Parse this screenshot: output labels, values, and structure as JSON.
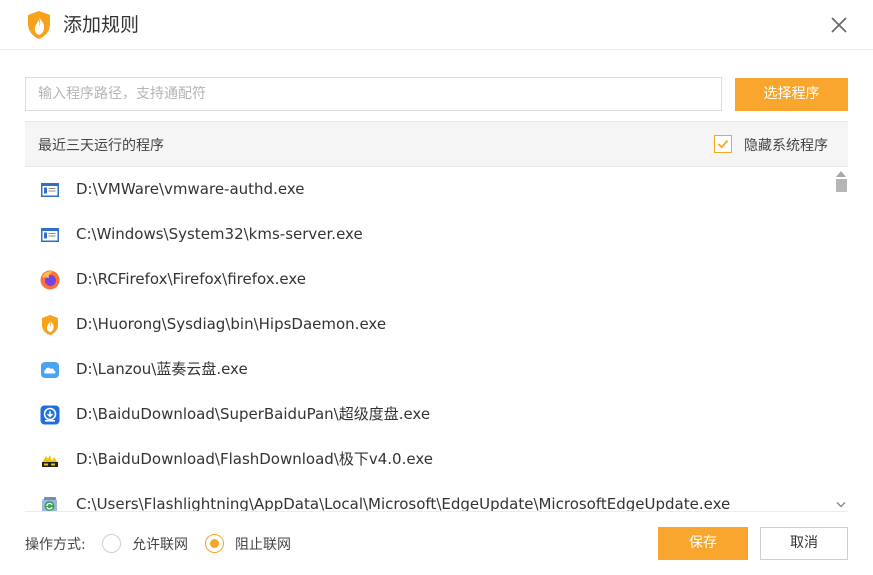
{
  "dialog": {
    "title": "添加规则",
    "app_icon": "huorong-flame-icon",
    "close_icon": "close-icon"
  },
  "search": {
    "placeholder": "输入程序路径，支持通配符",
    "value": "",
    "select_button": "选择程序"
  },
  "list_header": {
    "title": "最近三天运行的程序",
    "hide_system_label": "隐藏系统程序",
    "hide_system_checked": true
  },
  "programs": [
    {
      "path": "D:\\VMWare\\vmware-authd.exe",
      "icon": "window-app-icon"
    },
    {
      "path": "C:\\Windows\\System32\\kms-server.exe",
      "icon": "window-app-icon"
    },
    {
      "path": "D:\\RCFirefox\\Firefox\\firefox.exe",
      "icon": "firefox-icon"
    },
    {
      "path": "D:\\Huorong\\Sysdiag\\bin\\HipsDaemon.exe",
      "icon": "huorong-flame-icon"
    },
    {
      "path": "D:\\Lanzou\\蓝奏云盘.exe",
      "icon": "cloud-icon"
    },
    {
      "path": "D:\\BaiduDownload\\SuperBaiduPan\\超级度盘.exe",
      "icon": "download-icon"
    },
    {
      "path": "D:\\BaiduDownload\\FlashDownload\\极下v4.0.exe",
      "icon": "flash-download-icon"
    },
    {
      "path": "C:\\Users\\Flashlightning\\AppData\\Local\\Microsoft\\EdgeUpdate\\MicrosoftEdgeUpdate.exe",
      "icon": "edge-update-icon"
    }
  ],
  "footer": {
    "mode_label": "操作方式:",
    "allow_label": "允许联网",
    "block_label": "阻止联网",
    "selected": "block",
    "save_button": "保存",
    "cancel_button": "取消"
  },
  "colors": {
    "accent": "#f8a62e",
    "header_bg": "#f5f5f5"
  }
}
